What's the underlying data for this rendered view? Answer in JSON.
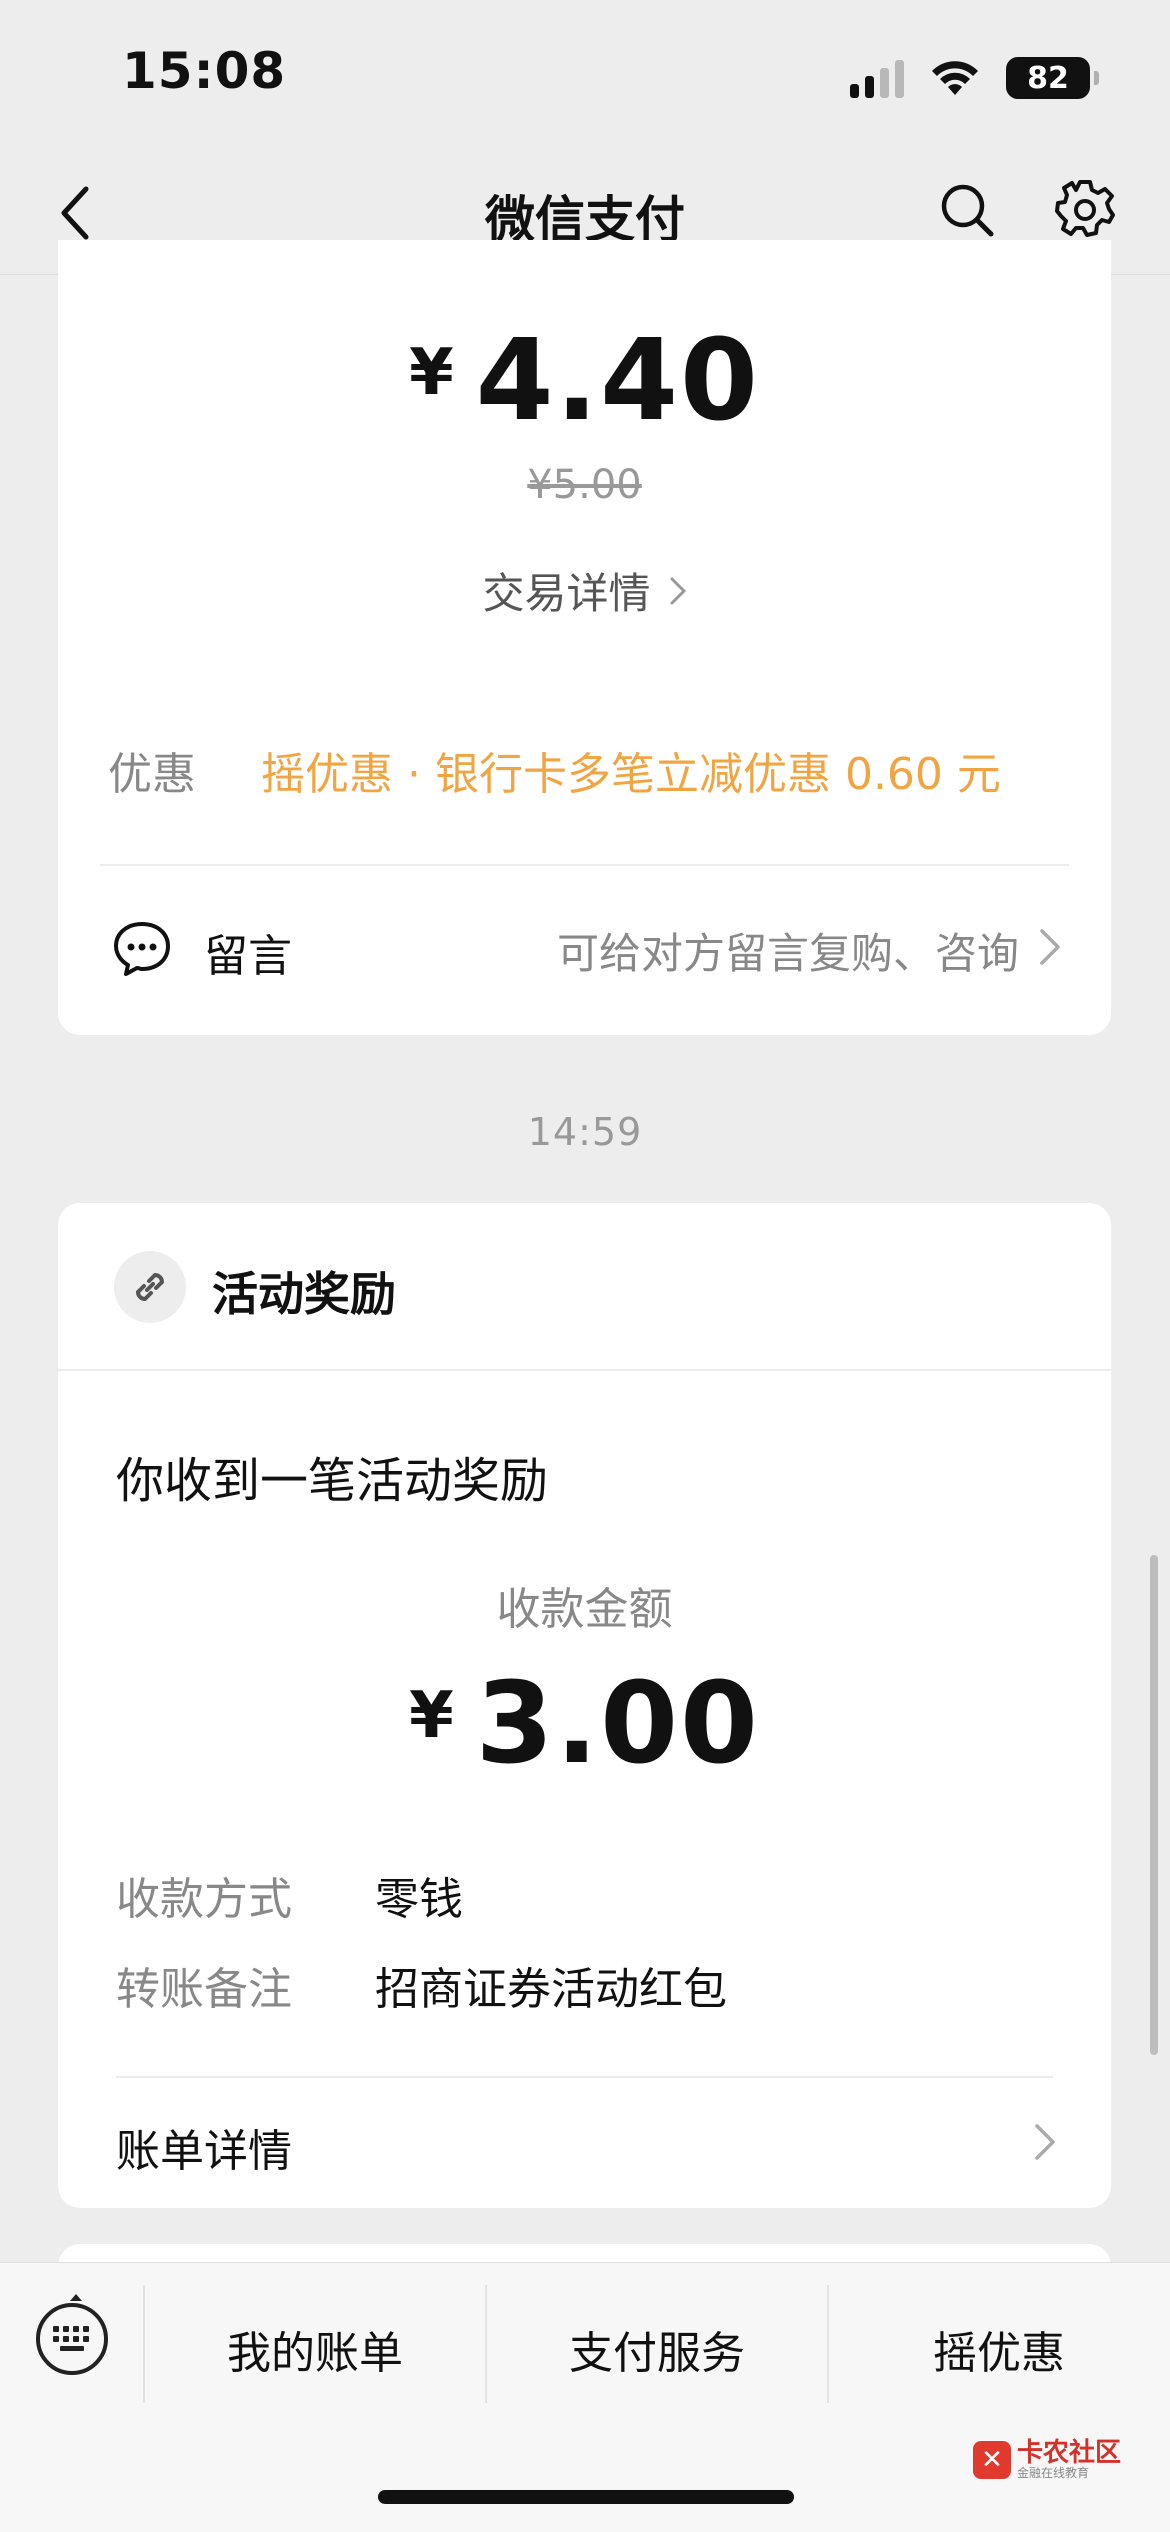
{
  "status_bar": {
    "time": "15:08",
    "battery": "82"
  },
  "nav": {
    "title": "微信支付"
  },
  "payment_card": {
    "currency": "¥",
    "amount": "4.40",
    "original_price": "¥5.00",
    "trade_details_link": "交易详情",
    "discount_label": "优惠",
    "discount_value": "摇优惠 · 银行卡多笔立减优惠 0.60 元",
    "message_label": "留言",
    "message_hint": "可给对方留言复购、咨询"
  },
  "time_separator": "14:59",
  "reward_card": {
    "header_title": "活动奖励",
    "headline": "你收到一笔活动奖励",
    "receive_label": "收款金额",
    "currency": "¥",
    "amount": "3.00",
    "details": [
      {
        "key": "收款方式",
        "value": "零钱"
      },
      {
        "key": "转账备注",
        "value": "招商证券活动红包"
      }
    ],
    "bill_details_label": "账单详情"
  },
  "toolbar": {
    "items": [
      "我的账单",
      "支付服务",
      "摇优惠"
    ]
  },
  "watermark": {
    "title": "卡农社区",
    "subtitle": "金融在线教育"
  },
  "colors": {
    "background": "#ededed",
    "discount_orange": "#f0a442",
    "card": "#ffffff"
  }
}
